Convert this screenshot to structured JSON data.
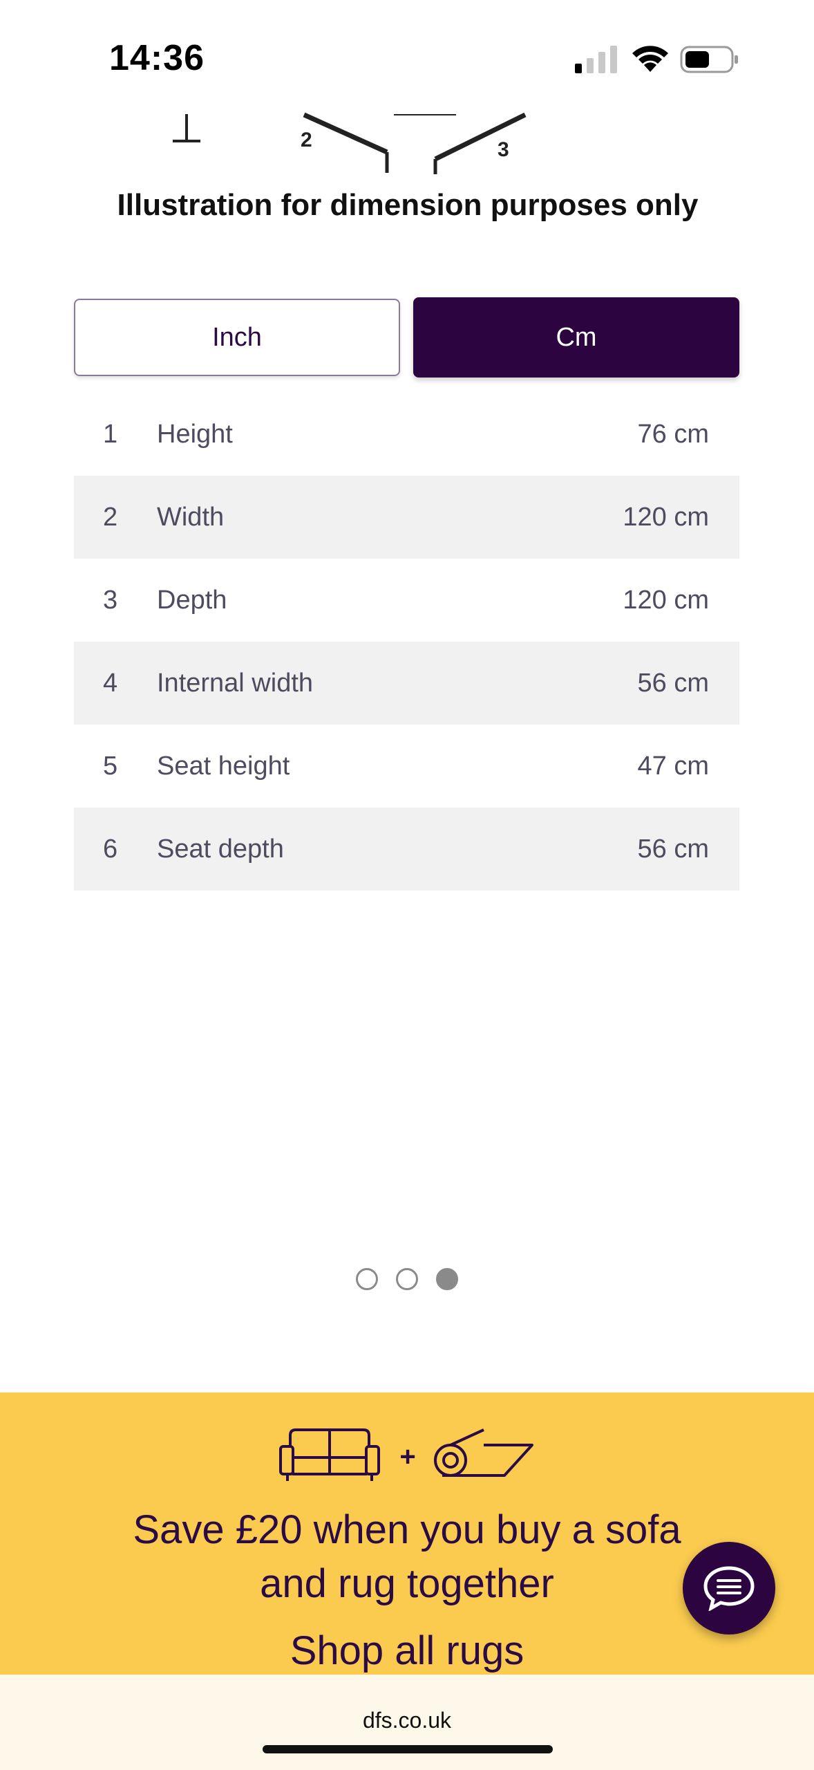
{
  "status_bar": {
    "time": "14:36"
  },
  "illustration": {
    "caption": "Illustration for dimension purposes only",
    "marker_labels": [
      "2",
      "3"
    ]
  },
  "unit_toggle": {
    "inch_label": "Inch",
    "cm_label": "Cm",
    "selected": "Cm"
  },
  "dimensions": [
    {
      "num": "1",
      "label": "Height",
      "value": "76 cm"
    },
    {
      "num": "2",
      "label": "Width",
      "value": "120 cm"
    },
    {
      "num": "3",
      "label": "Depth",
      "value": "120 cm"
    },
    {
      "num": "4",
      "label": "Internal width",
      "value": "56 cm"
    },
    {
      "num": "5",
      "label": "Seat height",
      "value": "47 cm"
    },
    {
      "num": "6",
      "label": "Seat depth",
      "value": "56 cm"
    }
  ],
  "carousel": {
    "total": 3,
    "active_index": 2
  },
  "promo": {
    "plus": "+",
    "line1": "Save £20 when you buy a sofa",
    "line2": "and rug together",
    "link": "Shop all rugs",
    "icons": [
      "sofa-icon",
      "rug-icon"
    ],
    "background": "#fbcb4f",
    "text_color": "#2a0b45"
  },
  "chat": {
    "icon": "chat-icon"
  },
  "browser": {
    "url": "dfs.co.uk"
  },
  "colors": {
    "accent": "#2c0440"
  }
}
